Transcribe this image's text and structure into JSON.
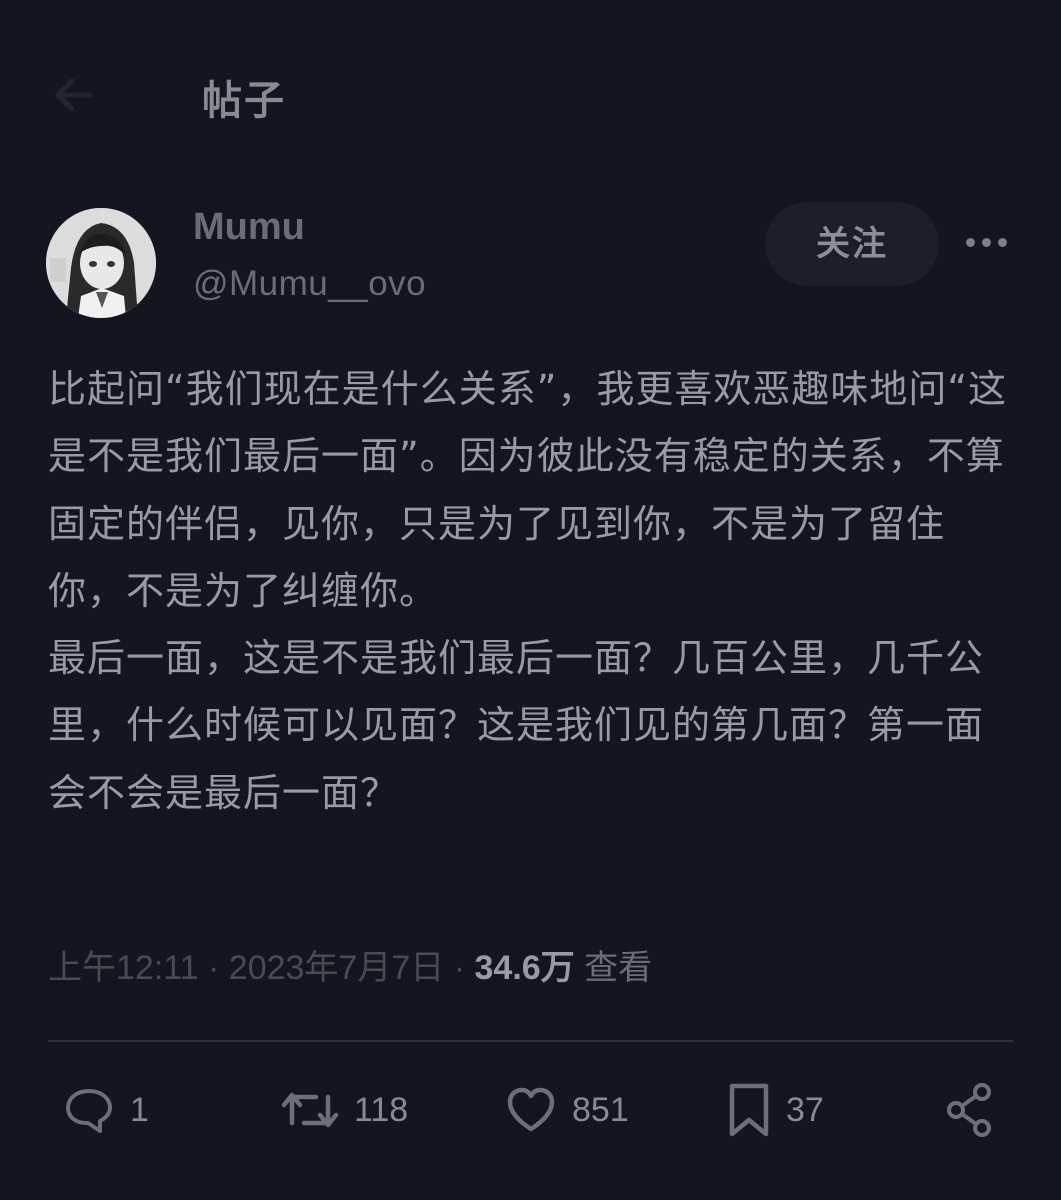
{
  "header": {
    "title": "帖子"
  },
  "author": {
    "display_name": "Mumu",
    "handle": "@Mumu__ovo"
  },
  "follow_label": "关注",
  "post": {
    "paragraphs": [
      "比起问“我们现在是什么关系”，我更喜欢恶趣味地问“这是不是我们最后一面”。因为彼此没有稳定的关系，不算固定的伴侣，见你，只是为了见到你，不是为了留住你，不是为了纠缠你。",
      "最后一面，这是不是我们最后一面？几百公里，几千公里，什么时候可以见面？这是我们见的第几面？第一面会不会是最后一面？"
    ]
  },
  "meta": {
    "time": "上午12:11",
    "date": "2023年7月7日",
    "separator": "·",
    "views_count": "34.6万",
    "views_label": "查看"
  },
  "actions": {
    "reply_count": "1",
    "retweet_count": "118",
    "like_count": "851",
    "bookmark_count": "37"
  },
  "icons": {
    "back": "back-arrow-icon",
    "more": "more-dots-icon",
    "reply": "reply-bubble-icon",
    "retweet": "retweet-icon",
    "like": "heart-icon",
    "bookmark": "bookmark-icon",
    "share": "share-icon"
  },
  "colors": {
    "background": "#15151f",
    "text": "#9a9aa4",
    "muted": "#4a4a53",
    "follow_button_bg": "#1e1e28"
  }
}
